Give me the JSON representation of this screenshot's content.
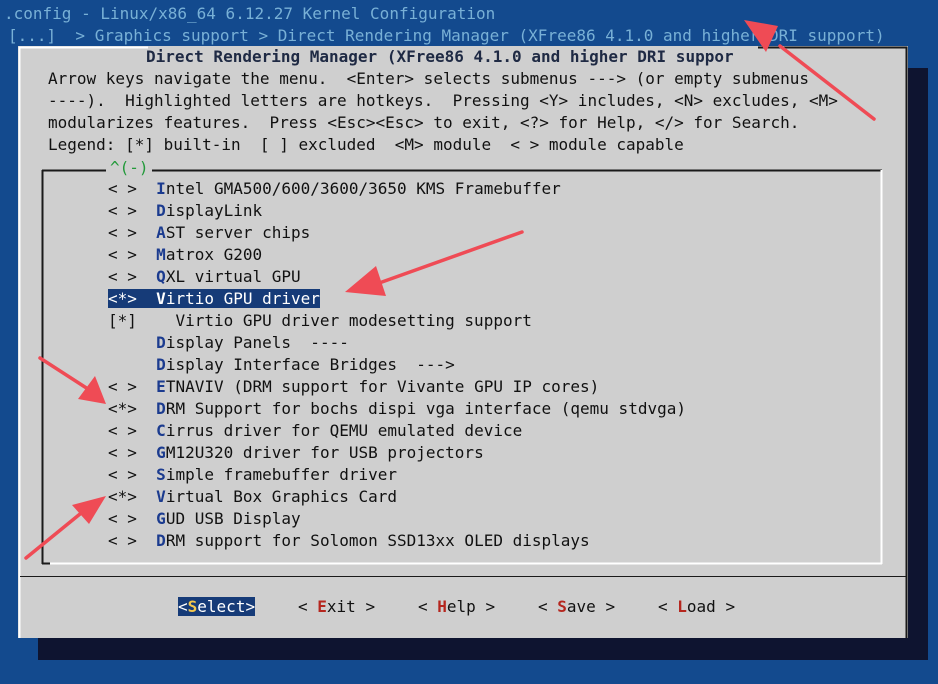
{
  "topbar": {
    "title": ".config - Linux/x86_64 6.12.27 Kernel Configuration",
    "breadcrumb": "[...]  > Graphics support > Direct Rendering Manager (XFree86 4.1.0 and higher DRI support)"
  },
  "dialog": {
    "title": "Direct Rendering Manager (XFree86 4.1.0 and higher DRI suppor",
    "help_lines": [
      "Arrow keys navigate the menu.  <Enter> selects submenus ---> (or empty submenus",
      "----).  Highlighted letters are hotkeys.  Pressing <Y> includes, <N> excludes, <M>",
      "modularizes features.  Press <Esc><Esc> to exit, <?> for Help, </> for Search.",
      "Legend: [*] built-in  [ ] excluded  <M> module  < > module capable"
    ],
    "scroll_indicator": "^(-)"
  },
  "menu": {
    "items": [
      {
        "state": "< >",
        "hot": "I",
        "rest": "ntel GMA500/600/3600/3650 KMS Framebuffer"
      },
      {
        "state": "< >",
        "hot": "D",
        "rest": "isplayLink"
      },
      {
        "state": "< >",
        "hot": "A",
        "rest": "ST server chips"
      },
      {
        "state": "< >",
        "hot": "M",
        "rest": "atrox G200"
      },
      {
        "state": "< >",
        "hot": "Q",
        "rest": "XL virtual GPU"
      },
      {
        "state": "<*>",
        "hot": "V",
        "rest": "irtio GPU driver"
      },
      {
        "state": "[*]",
        "hot": "",
        "rest": "Virtio GPU driver modesetting support"
      },
      {
        "state": "",
        "hot": "D",
        "rest": "isplay Panels  ----"
      },
      {
        "state": "",
        "hot": "D",
        "rest": "isplay Interface Bridges  --->"
      },
      {
        "state": "< >",
        "hot": "E",
        "rest": "TNAVIV (DRM support for Vivante GPU IP cores)"
      },
      {
        "state": "<*>",
        "hot": "D",
        "rest": "RM Support for bochs dispi vga interface (qemu stdvga)"
      },
      {
        "state": "< >",
        "hot": "C",
        "rest": "irrus driver for QEMU emulated device"
      },
      {
        "state": "< >",
        "hot": "G",
        "rest": "M12U320 driver for USB projectors"
      },
      {
        "state": "< >",
        "hot": "S",
        "rest": "imple framebuffer driver"
      },
      {
        "state": "<*>",
        "hot": "V",
        "rest": "irtual Box Graphics Card"
      },
      {
        "state": "< >",
        "hot": "G",
        "rest": "UD USB Display"
      },
      {
        "state": "< >",
        "hot": "D",
        "rest": "RM support for Solomon SSD13xx OLED displays"
      }
    ]
  },
  "buttons": [
    {
      "open": "<",
      "hot": "S",
      "rest": "elect",
      "close": ">"
    },
    {
      "open": "< ",
      "hot": "E",
      "rest": "xit",
      "close": " >"
    },
    {
      "open": "< ",
      "hot": "H",
      "rest": "elp",
      "close": " >"
    },
    {
      "open": "< ",
      "hot": "S",
      "rest": "ave",
      "close": " >"
    },
    {
      "open": "< ",
      "hot": "L",
      "rest": "oad",
      "close": " >"
    }
  ],
  "colors": {
    "terminal_background": "#134a8e",
    "dialog_background": "#cfcfcf",
    "selection": "#163b78",
    "hotkey": "#1b3b8f",
    "button_hotkey": "#b5261e",
    "annotation_arrow": "#ef4b55"
  }
}
